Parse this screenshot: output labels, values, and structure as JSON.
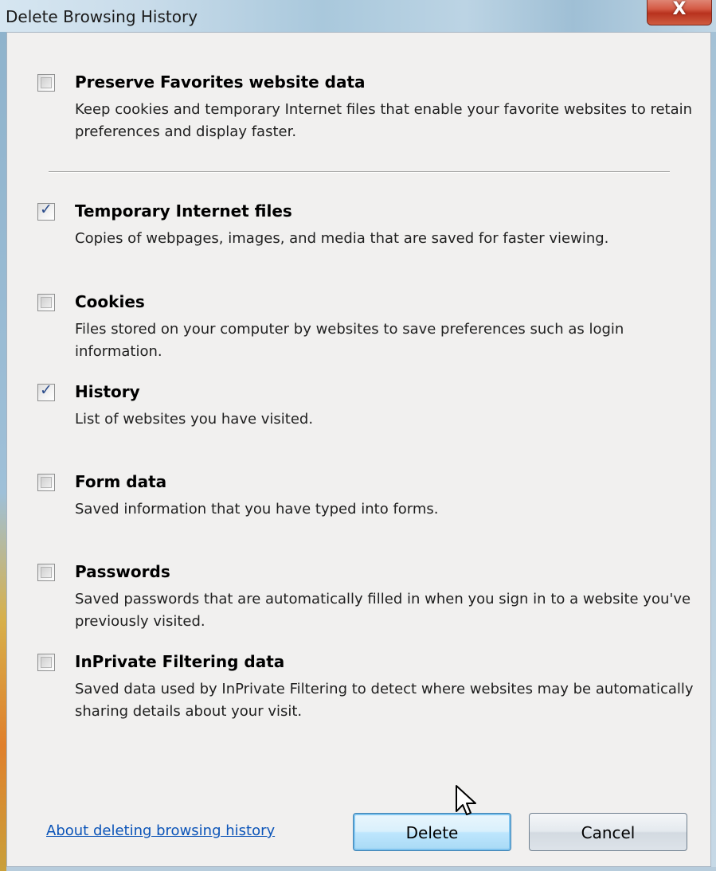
{
  "window": {
    "title": "Delete Browsing History",
    "close_glyph": "X"
  },
  "options": [
    {
      "title": "Preserve Favorites website data",
      "description": "Keep cookies and temporary Internet files that enable your favorite websites to retain preferences and display faster.",
      "checked": false
    },
    {
      "title": "Temporary Internet files",
      "description": "Copies of webpages, images, and media that are saved for faster viewing.",
      "checked": true
    },
    {
      "title": "Cookies",
      "description": "Files stored on your computer by websites to save preferences such as login information.",
      "checked": false
    },
    {
      "title": "History",
      "description": "List of websites you have visited.",
      "checked": true
    },
    {
      "title": "Form data",
      "description": "Saved information that you have typed into forms.",
      "checked": false
    },
    {
      "title": "Passwords",
      "description": "Saved passwords that are automatically filled in when you sign in to a website you've previously visited.",
      "checked": false
    },
    {
      "title": "InPrivate Filtering data",
      "description": "Saved data used by InPrivate Filtering to detect where websites may be automatically sharing details about your visit.",
      "checked": false
    }
  ],
  "footer": {
    "help_link": "About deleting browsing history",
    "delete_label": "Delete",
    "cancel_label": "Cancel"
  },
  "check_glyph": "✓",
  "colors": {
    "link": "#0b54b8",
    "check": "#2c4d8c",
    "close_button": "#c8432e"
  }
}
